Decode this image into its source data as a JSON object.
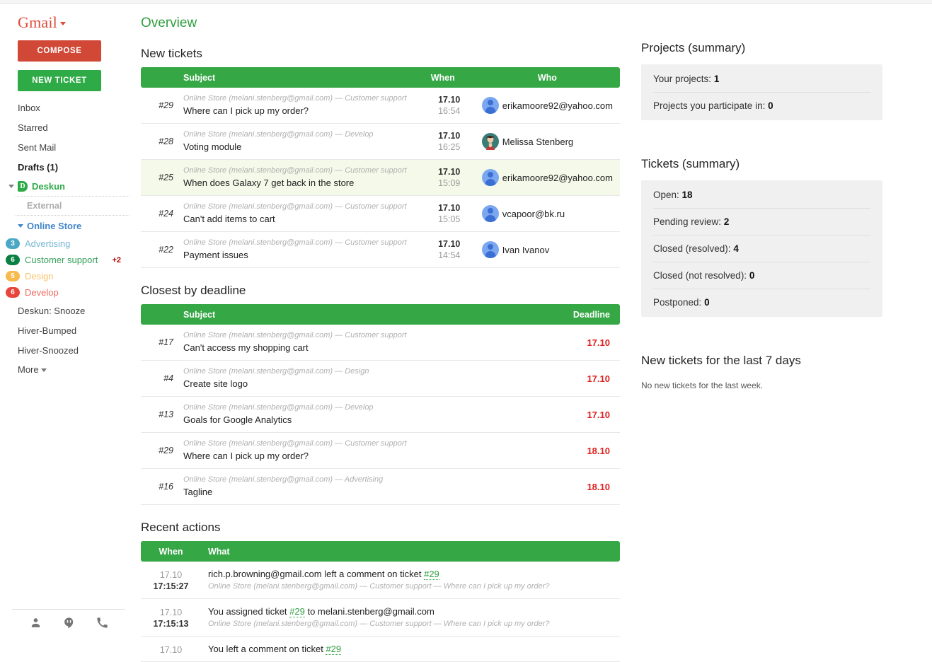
{
  "sidebar": {
    "brand": "Gmail",
    "compose_label": "COMPOSE",
    "new_ticket_label": "NEW TICKET",
    "nav": [
      {
        "label": "Inbox",
        "bold": false
      },
      {
        "label": "Starred",
        "bold": false
      },
      {
        "label": "Sent Mail",
        "bold": false
      },
      {
        "label": "Drafts (1)",
        "bold": true
      }
    ],
    "deskun": {
      "label": "Deskun",
      "badge": "D"
    },
    "external_label": "External",
    "online_store_label": "Online Store",
    "labels": [
      {
        "label": "Advertising",
        "count": "3",
        "color": "#4aa8c6",
        "text_color": "#76b7d4"
      },
      {
        "label": "Customer support",
        "count": "6",
        "color": "#0b8043",
        "text_color": "#36a05a",
        "extra": "+2"
      },
      {
        "label": "Design",
        "count": "5",
        "color": "#f8b94d",
        "text_color": "#f9c46c"
      },
      {
        "label": "Develop",
        "count": "6",
        "color": "#e8453c",
        "text_color": "#ec6b62"
      }
    ],
    "nav_bottom": [
      {
        "label": "Deskun: Snooze"
      },
      {
        "label": "Hiver-Bumped"
      },
      {
        "label": "Hiver-Snoozed"
      }
    ],
    "more_label": "More",
    "footer_icons": [
      "person-icon",
      "hangouts-icon",
      "phone-icon"
    ]
  },
  "main": {
    "page_title": "Overview",
    "new_tickets": {
      "title": "New tickets",
      "headers": {
        "id": "",
        "subject": "Subject",
        "when": "When",
        "who": "Who"
      },
      "rows": [
        {
          "id": "#29",
          "meta": "Online Store (melani.stenberg@gmail.com) — Customer support",
          "subject": "Where can I pick up my order?",
          "date": "17.10",
          "time": "16:54",
          "who": "erikamoore92@yahoo.com",
          "avatar": "generic",
          "highlight": false
        },
        {
          "id": "#28",
          "meta": "Online Store (melani.stenberg@gmail.com) — Develop",
          "subject": "Voting module",
          "date": "17.10",
          "time": "16:25",
          "who": "Melissa Stenberg",
          "avatar": "photo",
          "highlight": false
        },
        {
          "id": "#25",
          "meta": "Online Store (melani.stenberg@gmail.com) — Customer support",
          "subject": "When does Galaxy 7 get back in the store",
          "date": "17.10",
          "time": "15:09",
          "who": "erikamoore92@yahoo.com",
          "avatar": "generic",
          "highlight": true
        },
        {
          "id": "#24",
          "meta": "Online Store (melani.stenberg@gmail.com) — Customer support",
          "subject": "Can't add items to cart",
          "date": "17.10",
          "time": "15:05",
          "who": "vcapoor@bk.ru",
          "avatar": "generic",
          "highlight": false
        },
        {
          "id": "#22",
          "meta": "Online Store (melani.stenberg@gmail.com) — Customer support",
          "subject": "Payment issues",
          "date": "17.10",
          "time": "14:54",
          "who": "Ivan Ivanov",
          "avatar": "generic",
          "highlight": false
        }
      ]
    },
    "deadline": {
      "title": "Closest by deadline",
      "headers": {
        "id": "",
        "subject": "Subject",
        "deadline": "Deadline"
      },
      "rows": [
        {
          "id": "#17",
          "meta": "Online Store (melani.stenberg@gmail.com) — Customer support",
          "subject": "Can't access my shopping cart",
          "deadline": "17.10"
        },
        {
          "id": "#4",
          "meta": "Online Store (melani.stenberg@gmail.com) — Design",
          "subject": "Create site logo",
          "deadline": "17.10"
        },
        {
          "id": "#13",
          "meta": "Online Store (melani.stenberg@gmail.com) — Develop",
          "subject": "Goals for Google Analytics",
          "deadline": "17.10"
        },
        {
          "id": "#29",
          "meta": "Online Store (melani.stenberg@gmail.com) — Customer support",
          "subject": "Where can I pick up my order?",
          "deadline": "18.10"
        },
        {
          "id": "#16",
          "meta": "Online Store (melani.stenberg@gmail.com) — Advertising",
          "subject": "Tagline",
          "deadline": "18.10"
        }
      ]
    },
    "recent": {
      "title": "Recent actions",
      "headers": {
        "when": "When",
        "what": "What"
      },
      "rows": [
        {
          "date": "17.10",
          "time": "17:15:27",
          "what_pre": "rich.p.browning@gmail.com left a comment on ticket ",
          "link": "#29",
          "what_post": "",
          "sub": "Online Store (melani.stenberg@gmail.com) — Customer support — Where can I pick up my order?"
        },
        {
          "date": "17.10",
          "time": "17:15:13",
          "what_pre": "You assigned ticket ",
          "link": "#29",
          "what_post": " to melani.stenberg@gmail.com",
          "sub": "Online Store (melani.stenberg@gmail.com) — Customer support — Where can I pick up my order?"
        },
        {
          "date": "17.10",
          "time": "",
          "what_pre": "You left a comment on ticket ",
          "link": "#29",
          "what_post": "",
          "sub": ""
        }
      ]
    }
  },
  "right": {
    "projects": {
      "title": "Projects (summary)",
      "rows": [
        {
          "label": "Your projects:",
          "value": "1"
        },
        {
          "label": "Projects you participate in:",
          "value": "0"
        }
      ]
    },
    "tickets": {
      "title": "Tickets (summary)",
      "rows": [
        {
          "label": "Open:",
          "value": "18"
        },
        {
          "label": "Pending review:",
          "value": "2"
        },
        {
          "label": "Closed (resolved):",
          "value": "4"
        },
        {
          "label": "Closed (not resolved):",
          "value": "0"
        },
        {
          "label": "Postponed:",
          "value": "0"
        }
      ]
    },
    "last7": {
      "title": "New tickets for the last 7 days",
      "empty": "No new tickets for the last week."
    }
  },
  "colors": {
    "green_header": "#35a745",
    "compose_red": "#d14836",
    "new_ticket_green": "#2eab47",
    "deadline_red": "#e02020",
    "link_blue": "#4285c8"
  }
}
